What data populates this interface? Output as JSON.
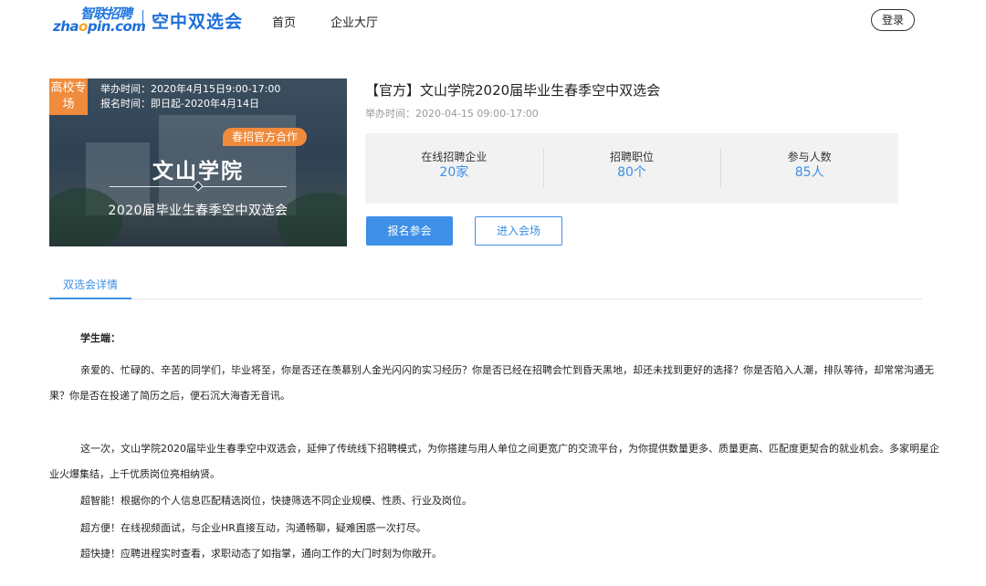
{
  "header": {
    "logo_brand_top": "智联招聘",
    "logo_brand_bottom_pre": "zha",
    "logo_brand_bottom_o": "o",
    "logo_brand_bottom_post": "pin.com",
    "logo_title": "空中双选会",
    "nav": [
      "首页",
      "企业大厅"
    ],
    "login_label": "登录"
  },
  "banner": {
    "tag": "高校专场",
    "hold_time": "举办时间：2020年4月15日9:00-17:00",
    "register_time": "报名时间：即日起-2020年4月14日",
    "badge": "春招官方合作",
    "school": "文山学院",
    "subtitle": "2020届毕业生春季空中双选会"
  },
  "event": {
    "title": "【官方】文山学院2020届毕业生春季空中双选会",
    "time": "举办时间：2020-04-15 09:00-17:00",
    "stats": [
      {
        "label": "在线招聘企业",
        "value": "20家"
      },
      {
        "label": "招聘职位",
        "value": "80个"
      },
      {
        "label": "参与人数",
        "value": "85人"
      }
    ],
    "register_button": "报名参会",
    "enter_button": "进入会场"
  },
  "tabs": {
    "active": "双选会详情"
  },
  "content": {
    "heading": "学生端：",
    "para1": "亲爱的、忙碌的、辛苦的同学们，毕业将至，你是否还在羡慕别人金光闪闪的实习经历？你是否已经在招聘会忙到昏天黑地，却还未找到更好的选择？你是否陷入人潮，排队等待，却常常沟通无果？你是否在投递了简历之后，便石沉大海杳无音讯。",
    "para2": "这一次，文山学院2020届毕业生春季空中双选会，延伸了传统线下招聘模式，为你搭建与用人单位之间更宽广的交流平台，为你提供数量更多、质量更高、匹配度更契合的就业机会。多家明星企业火爆集结，上千优质岗位亮相纳贤。",
    "para3": "超智能！根据你的个人信息匹配精选岗位，快捷筛选不同企业规模、性质、行业及岗位。",
    "para4": "超方便！在线视频面试，与企业HR直接互动，沟通畅聊，疑难困惑一次打尽。",
    "para5": "超快捷！应聘进程实时查看，求职动态了如指掌，通向工作的大门时刻为你敞开。"
  }
}
